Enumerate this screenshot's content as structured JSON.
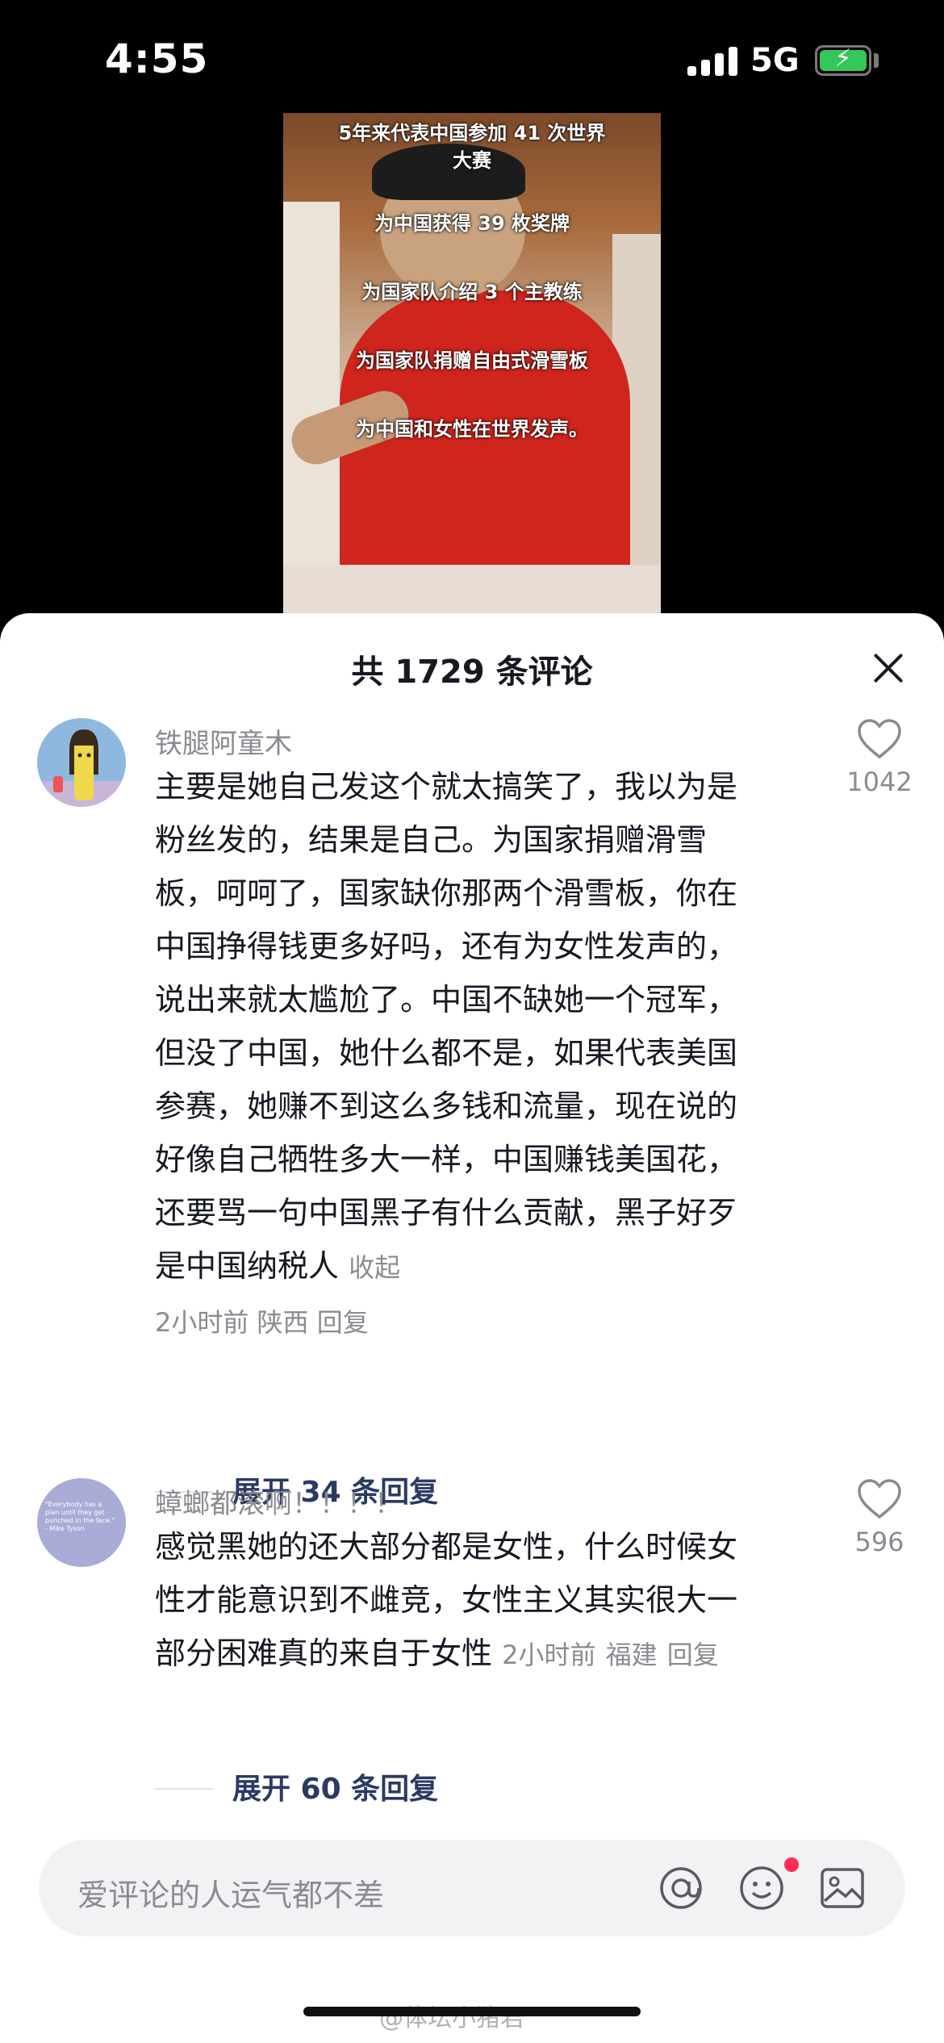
{
  "status_bar": {
    "time": "4:55",
    "network": "5G"
  },
  "video": {
    "captions": [
      "5年来代表中国参加 41 次世界",
      "大赛",
      "为中国获得 39 枚奖牌",
      "为国家队介绍 3 个主教练",
      "为国家队捐赠自由式滑雪板",
      "为中国和女性在世界发声。"
    ]
  },
  "sheet": {
    "title": "共 1729 条评论"
  },
  "comments": [
    {
      "username": "铁腿阿童木",
      "lines": [
        "主要是她自己发这个就太搞笑了，我以为是",
        "粉丝发的，结果是自己。为国家捐赠滑雪",
        "板，呵呵了，国家缺你那两个滑雪板，你在",
        "中国挣得钱更多好吗，还有为女性发声的，",
        "说出来就太尴尬了。中国不缺她一个冠军，",
        "但没了中国，她什么都不是，如果代表美国",
        "参赛，她赚不到这么多钱和流量，现在说的",
        "好像自己牺牲多大一样，中国赚钱美国花，",
        "还要骂一句中国黑子有什么贡献，黑子好歹",
        "是中国纳税人"
      ],
      "collapse": "收起",
      "time": "2小时前",
      "location": "陕西",
      "reply": "回复",
      "likes": "1042",
      "expand": "展开 34 条回复"
    },
    {
      "username": "蟑螂都滚啊！！！！",
      "avatar_text": "\"Everybody has a plan until they get punched in the face.\" - Mike Tyson",
      "lines": [
        "感觉黑她的还大部分都是女性，什么时候女",
        "性才能意识到不雌竞，女性主义其实很大一",
        "部分困难真的来自于女性"
      ],
      "time": "2小时前",
      "location": "福建",
      "reply": "回复",
      "likes": "596",
      "expand": "展开 60 条回复"
    }
  ],
  "input": {
    "placeholder": "爱评论的人运气都不差"
  },
  "watermark": "@体坛小猪君"
}
